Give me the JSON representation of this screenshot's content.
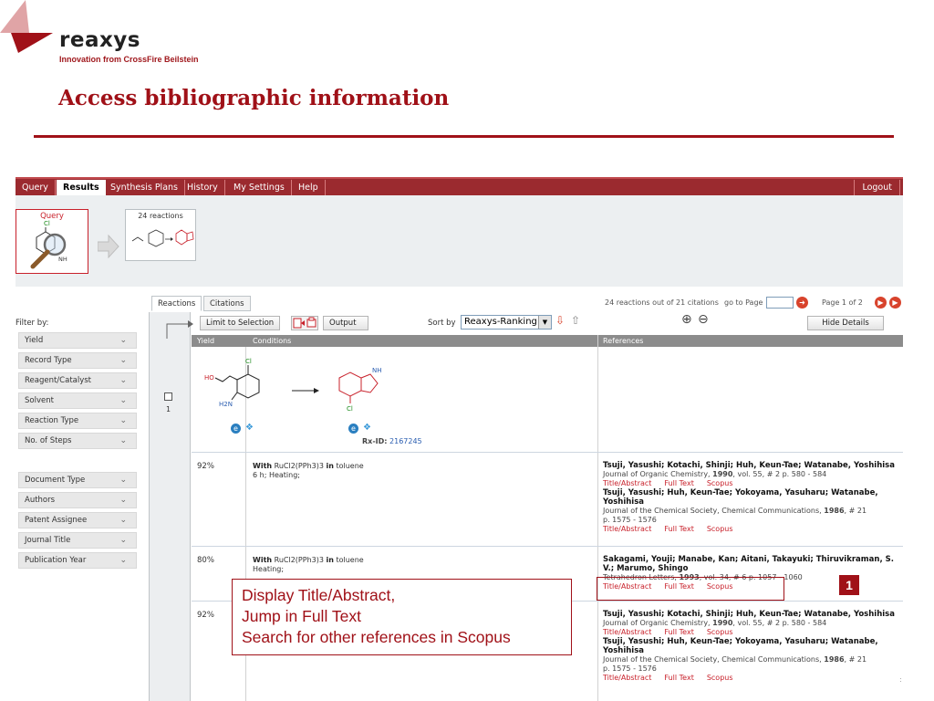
{
  "slide": {
    "logo_text": "reaxys",
    "logo_tagline": "Innovation from CrossFire Beilstein",
    "title": "Access bibliographic information",
    "page_marker": ":"
  },
  "colors": {
    "brand_red": "#a01118",
    "menubar": "#9b2a2f",
    "link_red": "#c8202a",
    "rxid_blue": "#2a5db0"
  },
  "menu": {
    "items": [
      "Query",
      "Results",
      "Synthesis Plans",
      "History",
      "My Settings",
      "Help"
    ],
    "active": "Results",
    "logout": "Logout"
  },
  "query_panel": {
    "query_label": "Query",
    "query_atom": "Cl",
    "query_nh": "NH",
    "reactions_label": "24 reactions"
  },
  "filter": {
    "heading": "Filter by:",
    "group1": [
      "Yield",
      "Record Type",
      "Reagent/Catalyst",
      "Solvent",
      "Reaction Type",
      "No. of Steps"
    ],
    "group2": [
      "Document Type",
      "Authors",
      "Patent Assignee",
      "Journal Title",
      "Publication Year"
    ],
    "expand_icon": "double-chevron-down-icon"
  },
  "tabs": {
    "reactions": "Reactions",
    "citations": "Citations"
  },
  "pager": {
    "summary": "24 reactions out of 21 citations",
    "go_to_page": "go to Page",
    "page_info": "Page 1 of 2"
  },
  "toolbar": {
    "limit_label": "Limit to Selection",
    "output_label": "Output",
    "sort_by_label": "Sort by",
    "sort_value": "Reaxys-Ranking",
    "hide_details": "Hide Details"
  },
  "columns": {
    "yield": "Yield",
    "conditions": "Conditions",
    "references": "References"
  },
  "reaction": {
    "row_number": "1",
    "rx_id_label": "Rx-ID:",
    "rx_id": "2167245",
    "reactant_labels": {
      "ho": "HO",
      "cl": "Cl",
      "nh2": "H2N"
    },
    "product_labels": {
      "nh": "NH",
      "cl": "Cl"
    }
  },
  "results": [
    {
      "yield": "92%",
      "cond_with": "With",
      "reagent": "RuCl2(PPh3)3",
      "cond_in": "in",
      "solvent": "toluene",
      "detail": "6 h; Heating;",
      "refs": [
        {
          "authors": "Tsuji, Yasushi; Kotachi, Shinji; Huh, Keun-Tae; Watanabe, Yoshihisa",
          "journal": "Journal of Organic Chemistry,",
          "year": "1990",
          "vol": ", vol. 55, # 2 p. 580 - 584"
        },
        {
          "authors": "Tsuji, Yasushi; Huh, Keun-Tae; Yokoyama, Yasuharu; Watanabe, Yoshihisa",
          "journal": "Journal of the Chemical Society, Chemical Communications,",
          "year": "1986",
          "vol": ", # 21",
          "pages": "p. 1575 - 1576"
        }
      ]
    },
    {
      "yield": "80%",
      "cond_with": "With",
      "reagent": "RuCl2(PPh3)3",
      "cond_in": "in",
      "solvent": "toluene",
      "detail": "Heating;",
      "refs": [
        {
          "authors": "Sakagami, Youji; Manabe, Kan; Aitani, Takayuki; Thiruvikraman, S. V.; Marumo, Shingo",
          "journal": "Tetrahedron Letters,",
          "year": "1993",
          "vol": ", vol. 34, # 6 p. 1057 - 1060"
        }
      ]
    },
    {
      "yield": "92%",
      "refs": [
        {
          "authors": "Tsuji, Yasushi; Kotachi, Shinji; Huh, Keun-Tae; Watanabe, Yoshihisa",
          "journal": "Journal of Organic Chemistry,",
          "year": "1990",
          "vol": ", vol. 55, # 2 p. 580 - 584"
        },
        {
          "authors": "Tsuji, Yasushi; Huh, Keun-Tae; Yokoyama, Yasuharu; Watanabe, Yoshihisa",
          "journal": "Journal of the Chemical Society, Chemical Communications,",
          "year": "1986",
          "vol": ", # 21",
          "pages": "p. 1575 - 1576"
        }
      ]
    }
  ],
  "ref_links": {
    "title_abstract": "Title/Abstract",
    "full_text": "Full Text",
    "scopus": "Scopus"
  },
  "callout": {
    "line1": "Display Title/Abstract,",
    "line2": "Jump in Full Text",
    "line3": "Search for other references in Scopus",
    "badge": "1"
  }
}
